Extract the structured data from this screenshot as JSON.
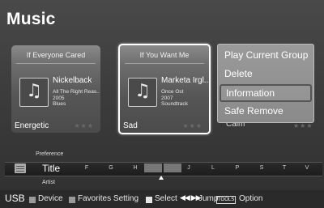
{
  "app": {
    "title": "Music"
  },
  "cards": [
    {
      "header": "If Everyone Cared",
      "artist": "Nickelback",
      "album": "All The Right Reas..",
      "year": "2005",
      "genre": "Blues",
      "mood": "Energetic",
      "stars": "★★★",
      "icon": "music-note-icon"
    },
    {
      "header": "If You Want Me",
      "artist": "Marketa Irgl...",
      "album": "Once Ost",
      "year": "2007",
      "genre": "Soundtrack",
      "mood": "Sad",
      "stars": "★★★",
      "icon": "music-note-icon"
    },
    {
      "mood": "Calm",
      "stars": "★★★"
    }
  ],
  "menu": {
    "items": [
      "Play Current Group",
      "Delete",
      "Information",
      "Safe Remove"
    ],
    "active_index": 2
  },
  "sortbar": {
    "above_label": "Preference",
    "current": "Title",
    "below_label": "Artist",
    "letters": [
      "F",
      "G",
      "H",
      "J",
      "L",
      "P",
      "S",
      "T",
      "V"
    ]
  },
  "bottom": {
    "source": "USB",
    "device": "Device",
    "favorites": "Favorites Setting",
    "select": "Select",
    "jump": "Jump",
    "tools": "TOOLS",
    "option": "Option"
  },
  "colors": {
    "background": "#3a3a3a",
    "card": "#5a5a5a",
    "menu": "#8f8f8f",
    "selected_border": "#ffffff"
  }
}
